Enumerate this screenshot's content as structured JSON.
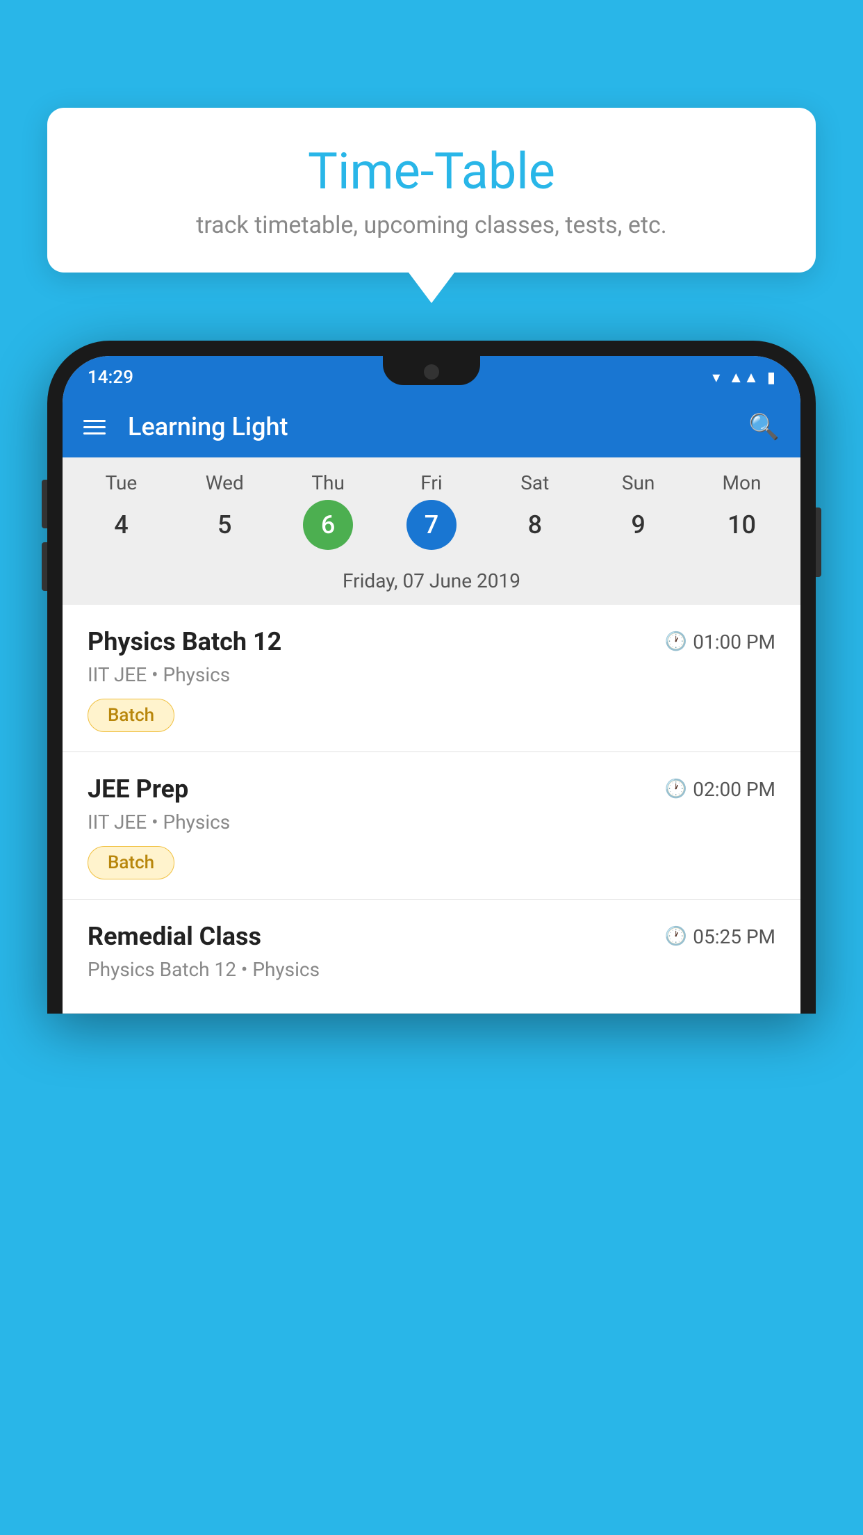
{
  "background": {
    "color": "#29b6e8"
  },
  "tooltip": {
    "title": "Time-Table",
    "subtitle": "track timetable, upcoming classes, tests, etc."
  },
  "phone": {
    "statusBar": {
      "time": "14:29"
    },
    "appBar": {
      "title": "Learning Light"
    },
    "calendar": {
      "days": [
        "Tue",
        "Wed",
        "Thu",
        "Fri",
        "Sat",
        "Sun",
        "Mon"
      ],
      "dates": [
        "4",
        "5",
        "6",
        "7",
        "8",
        "9",
        "10"
      ],
      "todayIndex": 2,
      "selectedIndex": 3,
      "selectedDateLabel": "Friday, 07 June 2019"
    },
    "schedule": [
      {
        "title": "Physics Batch 12",
        "time": "01:00 PM",
        "subtitle": "IIT JEE • Physics",
        "tag": "Batch"
      },
      {
        "title": "JEE Prep",
        "time": "02:00 PM",
        "subtitle": "IIT JEE • Physics",
        "tag": "Batch"
      },
      {
        "title": "Remedial Class",
        "time": "05:25 PM",
        "subtitle": "Physics Batch 12 • Physics",
        "tag": ""
      }
    ]
  }
}
